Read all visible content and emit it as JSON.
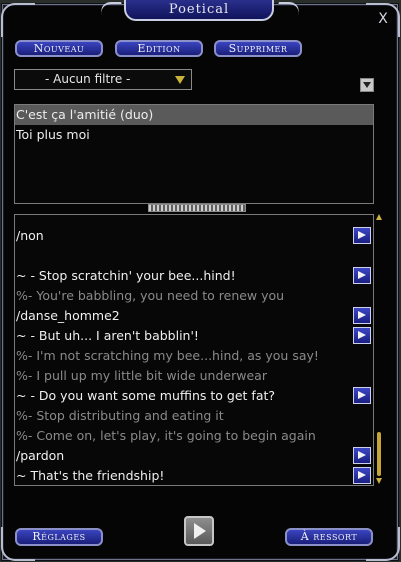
{
  "window": {
    "title": "Poetical",
    "close_glyph": "X"
  },
  "toolbar": {
    "new_label": "Nouveau",
    "edit_label": "Edition",
    "delete_label": "Supprimer"
  },
  "filter": {
    "selected": "- Aucun filtre -"
  },
  "list": {
    "items": [
      {
        "label": "C'est ça l'amitié (duo)",
        "selected": true
      },
      {
        "label": "Toi plus moi",
        "selected": false
      }
    ]
  },
  "commands": {
    "lines": [
      {
        "text": "/non",
        "style": "bright",
        "has_button": true
      },
      {
        "text": "",
        "style": "bright",
        "has_button": false
      },
      {
        "text": "~ - Stop scratchin' your bee...hind!",
        "style": "bright",
        "has_button": true
      },
      {
        "text": "%- You're babbling, you need to renew you",
        "style": "dim",
        "has_button": false
      },
      {
        "text": "/danse_homme2",
        "style": "bright",
        "has_button": true
      },
      {
        "text": "~ - But uh... I aren't babblin'!",
        "style": "bright",
        "has_button": true
      },
      {
        "text": "%- I'm not scratching my bee...hind, as you say!",
        "style": "dim",
        "has_button": false
      },
      {
        "text": "%- I pull up my little bit wide underwear",
        "style": "dim",
        "has_button": false
      },
      {
        "text": "~ - Do you want some muffins to get fat?",
        "style": "bright",
        "has_button": true
      },
      {
        "text": "%- Stop distributing and eating it",
        "style": "dim",
        "has_button": false
      },
      {
        "text": "%- Come on, let's play, it's going to begin again",
        "style": "dim",
        "has_button": false
      },
      {
        "text": "/pardon",
        "style": "bright",
        "has_button": true
      },
      {
        "text": "~ That's the friendship!",
        "style": "bright",
        "has_button": true
      }
    ]
  },
  "footer": {
    "settings_label": "Réglages",
    "spring_label": "À ressort"
  },
  "colors": {
    "accent_blue": "#2a33a8",
    "scroll_gold": "#c7a437"
  }
}
